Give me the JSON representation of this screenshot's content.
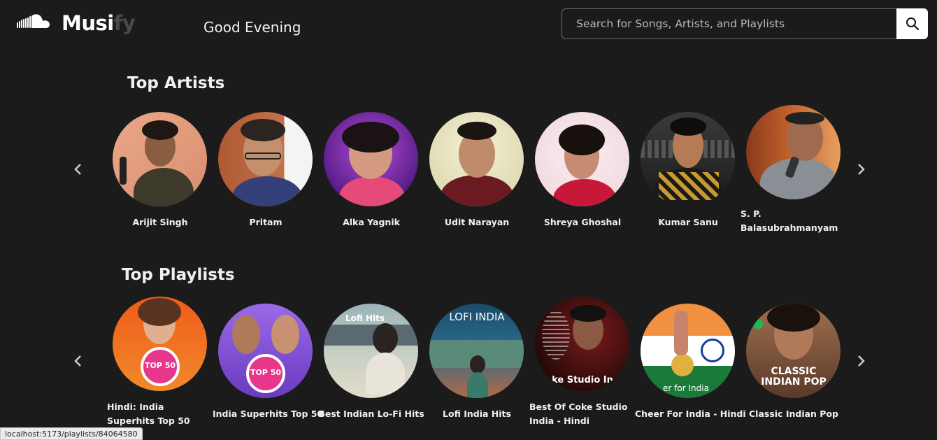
{
  "app": {
    "name_part1": "Musi",
    "name_part2": "fy",
    "greeting": "Good Evening"
  },
  "search": {
    "placeholder": "Search for Songs, Artists, and Playlists",
    "value": ""
  },
  "top_artists": {
    "title": "Top Artists",
    "items": [
      {
        "name": "Arijit Singh"
      },
      {
        "name": "Pritam"
      },
      {
        "name": "Alka Yagnik"
      },
      {
        "name": "Udit Narayan"
      },
      {
        "name": "Shreya Ghoshal"
      },
      {
        "name": "Kumar Sanu"
      },
      {
        "name": "S. P. Balasubrahmanyam"
      }
    ]
  },
  "top_playlists": {
    "title": "Top Playlists",
    "items": [
      {
        "name": "Hindi: India Superhits Top 50",
        "art_text": "TOP 50"
      },
      {
        "name": "India Superhits Top 50",
        "art_text": "TOP 50"
      },
      {
        "name": "Best Indian Lo-Fi Hits",
        "art_text": "Lofi Hits"
      },
      {
        "name": "Lofi India Hits",
        "art_text": "LOFI INDIA"
      },
      {
        "name": "Best Of Coke Studio India - Hindi",
        "art_text": "ke Studio In"
      },
      {
        "name": "Cheer For India - Hindi",
        "art_text": "er for India"
      },
      {
        "name": "Classic Indian Pop",
        "art_text": "CLASSIC INDIAN POP"
      }
    ]
  },
  "status_url": "localhost:5173/playlists/84064580",
  "icons": {
    "logo": "cloud-icon",
    "search": "search-icon",
    "prev": "chevron-left-icon",
    "next": "chevron-right-icon"
  },
  "colors": {
    "background": "#1c1b1c",
    "text": "#ffffff",
    "logo_dim": "#4a4a4a"
  }
}
